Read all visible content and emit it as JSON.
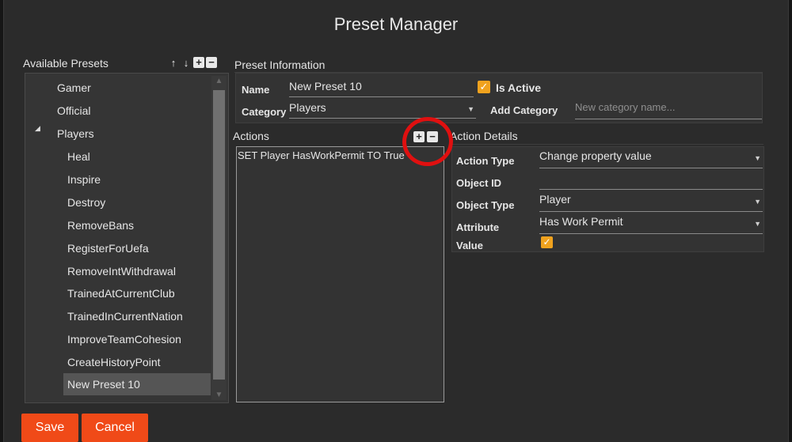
{
  "window": {
    "title": "Preset Manager"
  },
  "presets": {
    "header": "Available Presets",
    "items": [
      {
        "label": "Gamer",
        "level": 0
      },
      {
        "label": "Official",
        "level": 0
      },
      {
        "label": "Players",
        "level": 0,
        "expander": "◢"
      },
      {
        "label": "Heal",
        "level": 1
      },
      {
        "label": "Inspire",
        "level": 1
      },
      {
        "label": "Destroy",
        "level": 1
      },
      {
        "label": "RemoveBans",
        "level": 1
      },
      {
        "label": "RegisterForUefa",
        "level": 1
      },
      {
        "label": "RemoveIntWithdrawal",
        "level": 1
      },
      {
        "label": "TrainedAtCurrentClub",
        "level": 1
      },
      {
        "label": "TrainedInCurrentNation",
        "level": 1
      },
      {
        "label": "ImproveTeamCohesion",
        "level": 1
      },
      {
        "label": "CreateHistoryPoint",
        "level": 1
      },
      {
        "label": "New Preset 10",
        "level": 1,
        "selected": true
      }
    ],
    "icons": [
      "arrow-up-icon",
      "arrow-down-icon",
      "plus-icon",
      "minus-icon"
    ]
  },
  "info": {
    "header": "Preset Information",
    "name_label": "Name",
    "name_value": "New Preset 10",
    "is_active_label": "Is Active",
    "is_active": true,
    "category_label": "Category",
    "category_value": "Players",
    "add_category_label": "Add Category",
    "add_category_placeholder": "New category name..."
  },
  "actions": {
    "header": "Actions",
    "items": [
      "SET Player HasWorkPermit TO True"
    ]
  },
  "details": {
    "header": "Action Details",
    "action_type_label": "Action Type",
    "action_type_value": "Change property value",
    "object_id_label": "Object ID",
    "object_id_value": "",
    "object_type_label": "Object Type",
    "object_type_value": "Player",
    "attribute_label": "Attribute",
    "attribute_value": "Has Work Permit",
    "value_label": "Value",
    "value_checked": true
  },
  "footer": {
    "save_label": "Save",
    "cancel_label": "Cancel"
  },
  "colors": {
    "accent": "#f04a18",
    "checkbox": "#f0a21e",
    "annotation": "#e01010"
  }
}
